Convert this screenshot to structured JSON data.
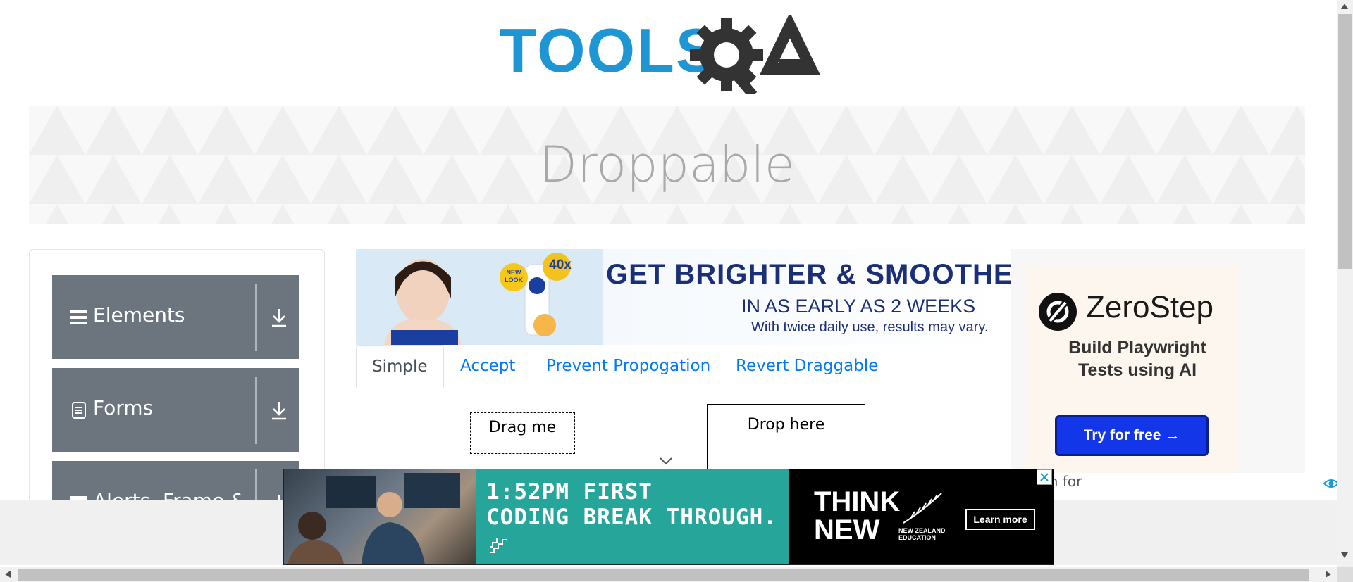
{
  "header": {
    "logo_text": "TOOLSQA"
  },
  "banner": {
    "title": "Droppable"
  },
  "sidebar": {
    "groups": [
      {
        "label": "Elements",
        "icon": "hamburger-icon"
      },
      {
        "label": "Forms",
        "icon": "document-icon"
      },
      {
        "label": "Alerts, Frame & Windows",
        "icon": "window-icon"
      }
    ]
  },
  "main_ad": {
    "headline": "GET BRIGHTER & SMOOTHER",
    "line2": "IN AS EARLY AS 2 WEEKS",
    "line3": "With twice daily use, results may vary.",
    "badge_new": "NEW LOOK",
    "badge_vit": "40x"
  },
  "tabs": [
    {
      "label": "Simple",
      "active": true
    },
    {
      "label": "Accept",
      "active": false
    },
    {
      "label": "Prevent Propogation",
      "active": false
    },
    {
      "label": "Revert Draggable",
      "active": false
    }
  ],
  "draggable": {
    "label": "Drag me"
  },
  "droppable": {
    "label": "Drop here"
  },
  "right_ad": {
    "brand": "ZeroStep",
    "tagline": "Build Playwright Tests using AI",
    "cta": "Try for free →"
  },
  "search": {
    "placeholder": "rch for"
  },
  "bottom_ad": {
    "line1": "1:52PM FIRST",
    "line2": "CODING BREAK THROUGH.",
    "think1": "THINK",
    "think2": "NEW",
    "nz": "NEW ZEALAND EDUCATION",
    "cta": "Learn more"
  },
  "colors": {
    "sidebar_group": "#6c757d",
    "tab_link": "#007bff",
    "logo_blue": "#1d96d3",
    "logo_dark": "#333333",
    "cta_blue": "#1337e8",
    "ad_teal": "#26a59a"
  }
}
